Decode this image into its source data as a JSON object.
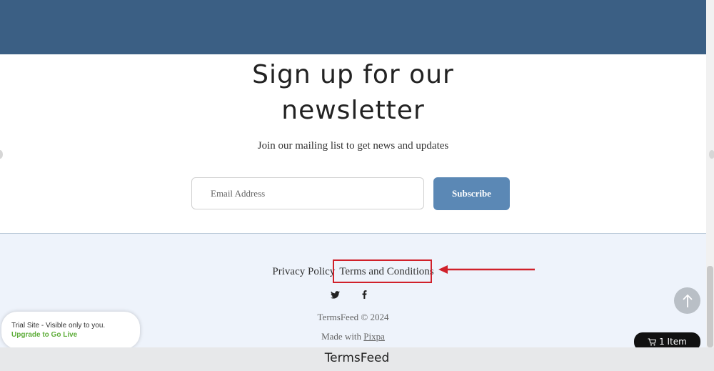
{
  "newsletter": {
    "title_line1": "Sign up for our",
    "title_line2": "newsletter",
    "subtitle": "Join our mailing list to get news and updates",
    "email_placeholder": "Email Address",
    "subscribe_label": "Subscribe"
  },
  "footer": {
    "links": [
      "Privacy Policy",
      "Terms and Conditions"
    ],
    "social_icons": [
      "twitter-icon",
      "facebook-icon"
    ],
    "copyright": "TermsFeed © 2024",
    "made_with_prefix": "Made with",
    "made_with_link": "Pixpa"
  },
  "trial_banner": {
    "text": "Trial Site - Visible only to you.",
    "link": "Upgrade to Go Live"
  },
  "cart": {
    "label": "1 Item"
  },
  "bottom_caption": "TermsFeed",
  "colors": {
    "header_band": "#3b5f84",
    "subscribe_button": "#5b88b5",
    "footer_bg": "#eef3fb",
    "highlight": "#d0202a",
    "upgrade_link": "#5fae3b"
  }
}
